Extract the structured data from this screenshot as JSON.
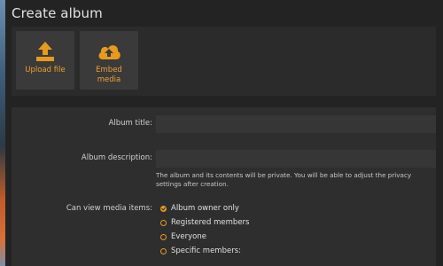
{
  "dialog": {
    "title": "Create album"
  },
  "upload": {
    "upload_file_label": "Upload file",
    "embed_media_line1": "Embed",
    "embed_media_line2": "media",
    "upload_icon": "upload-tray-arrow-icon",
    "embed_icon": "cloud-upload-icon"
  },
  "form": {
    "album_title": {
      "label": "Album title:",
      "value": "",
      "placeholder": ""
    },
    "album_description": {
      "label": "Album description:",
      "value": "",
      "placeholder": ""
    },
    "privacy_note": "The album and its contents will be private. You will be able to adjust the privacy settings after creation.",
    "view_permissions": {
      "label": "Can view media items:",
      "options": [
        {
          "label": "Album owner only",
          "checked": true
        },
        {
          "label": "Registered members",
          "checked": false
        },
        {
          "label": "Everyone",
          "checked": false
        },
        {
          "label": "Specific members:",
          "checked": false
        }
      ]
    }
  },
  "colors": {
    "accent": "#e89a1c",
    "background": "#232323",
    "panel": "#2e2e2e",
    "tile": "#3a3a3a",
    "input": "#363636"
  }
}
